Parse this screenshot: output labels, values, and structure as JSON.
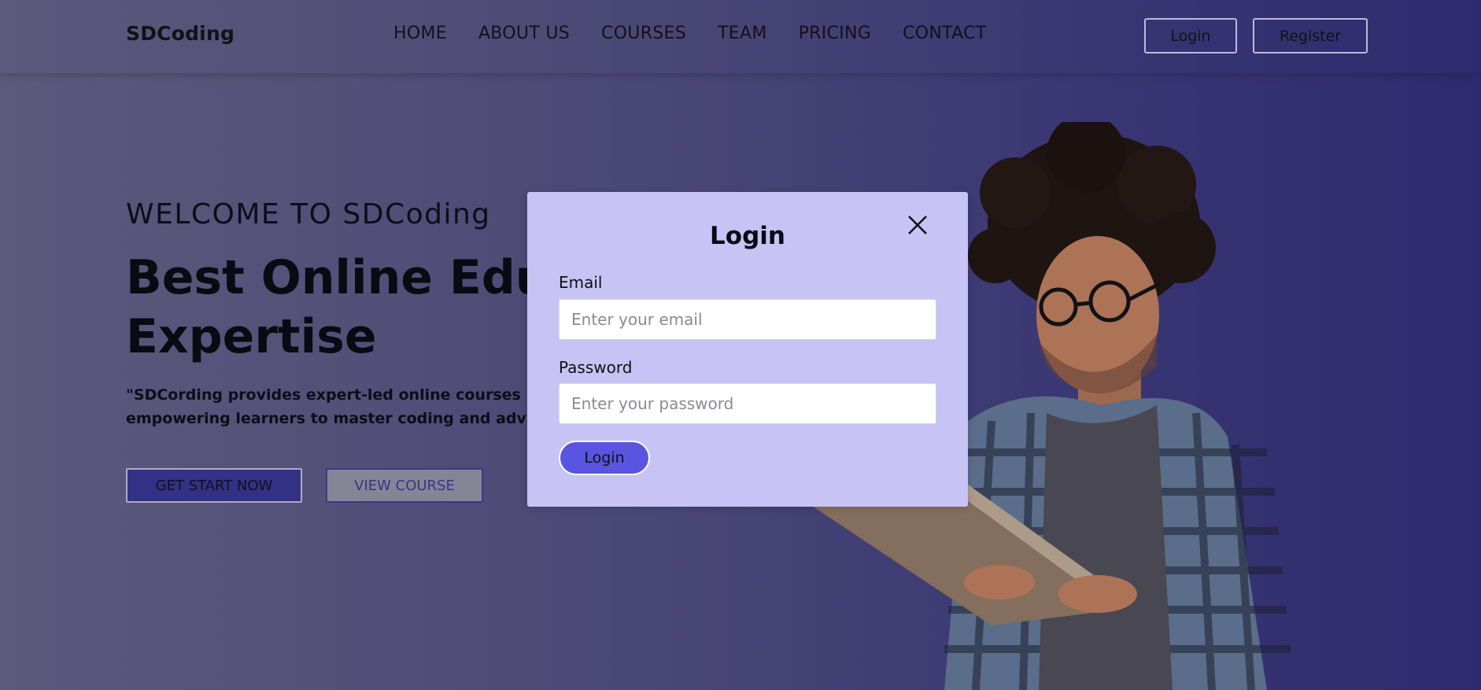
{
  "header": {
    "brand": "SDCoding",
    "nav": [
      "HOME",
      "ABOUT US",
      "COURSES",
      "TEAM",
      "PRICING",
      "CONTACT"
    ],
    "login_label": "Login",
    "register_label": "Register"
  },
  "hero": {
    "welcome": "WELCOME TO SDCoding",
    "headline_line1": "Best Online Educ",
    "headline_line2": "Expertise",
    "desc_line1": "\"SDCording provides expert-led online courses in s",
    "desc_line2": "empowering learners to master coding and advan",
    "start_label": "GET START NOW",
    "course_label": "VIEW COURSE"
  },
  "modal": {
    "title": "Login",
    "email_label": "Email",
    "email_placeholder": "Enter your email",
    "password_label": "Password",
    "password_placeholder": "Enter your password",
    "submit_label": "Login",
    "close_icon": "close-icon"
  },
  "colors": {
    "modal_bg": "#c7c3f4",
    "primary": "#5a55e0",
    "start_button": "#35328a"
  }
}
